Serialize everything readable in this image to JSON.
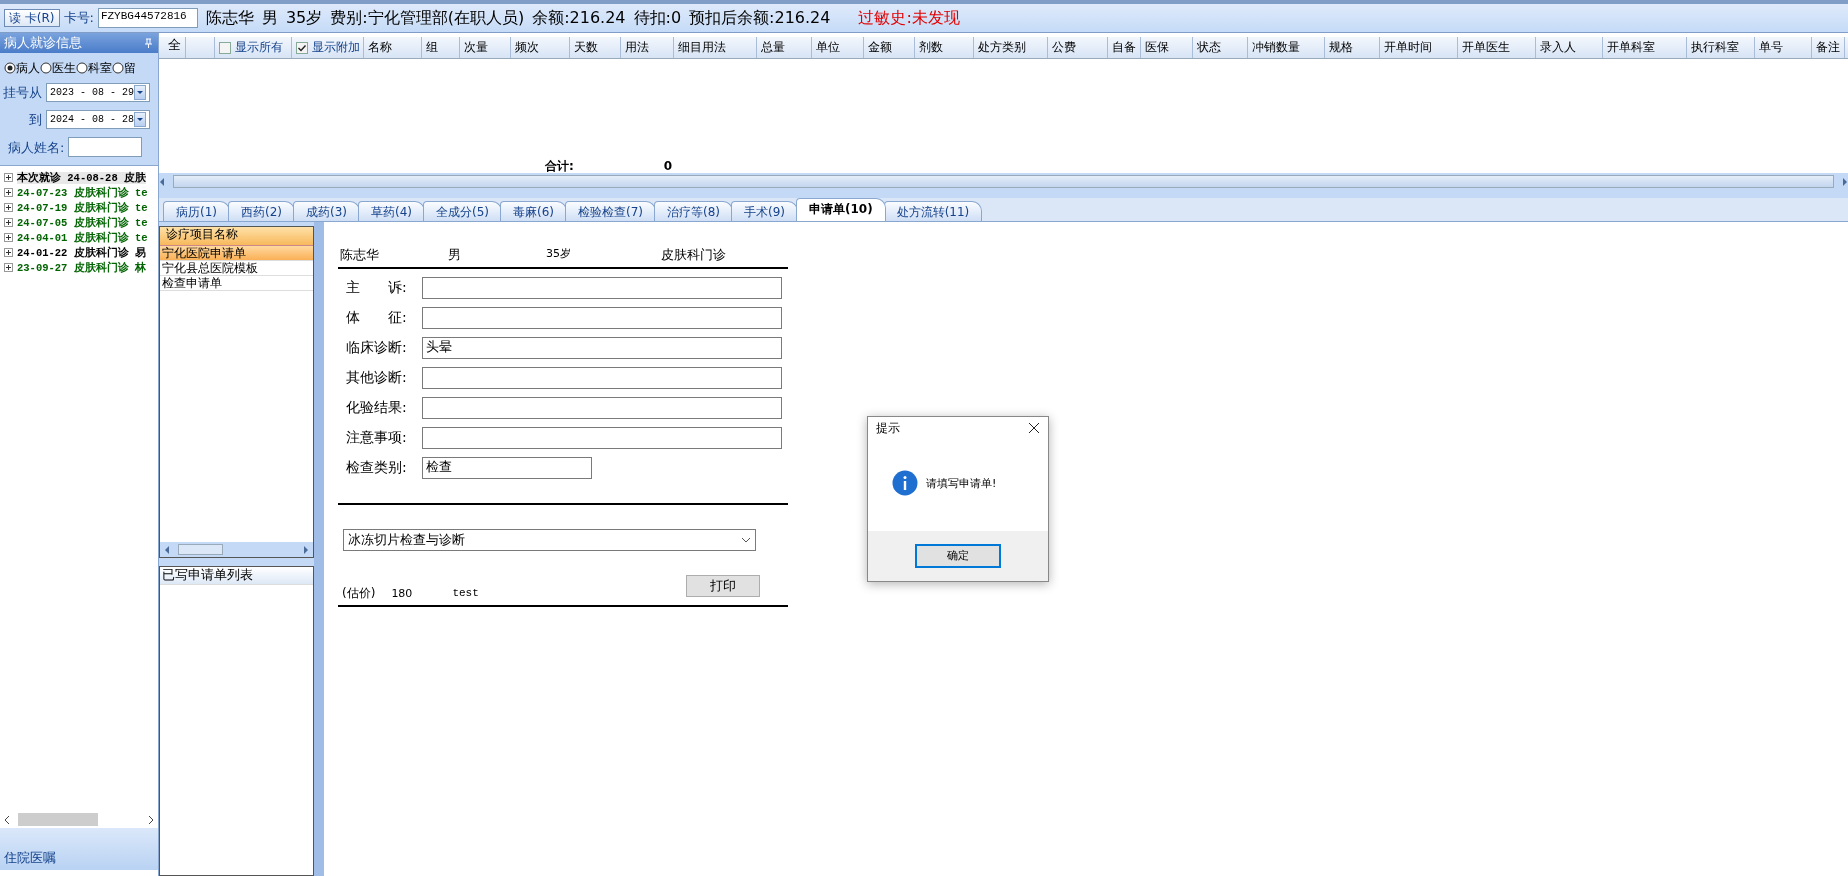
{
  "header": {
    "read_card_button": "读 卡(R)",
    "card_label": "卡号:",
    "card_number": "FZYBG44572816",
    "patient_info": [
      "陈志华",
      "男",
      "35岁",
      "费别:宁化管理部(在职人员)",
      "余额:216.24",
      "待扣:0",
      "预扣后余额:216.24"
    ],
    "allergy": "过敏史:未发现"
  },
  "left_panel": {
    "title": "病人就诊信息",
    "filter_options": [
      {
        "label": "病人",
        "selected": true
      },
      {
        "label": "医生",
        "selected": false
      },
      {
        "label": "科室",
        "selected": false
      },
      {
        "label": "留",
        "selected": false
      }
    ],
    "date_from": {
      "label": "挂号从",
      "value": "2023 - 08 - 29"
    },
    "date_to": {
      "label": "到",
      "value": "2024 - 08 - 28"
    },
    "patient_name": {
      "label": "病人姓名:"
    },
    "visits": [
      {
        "text": "本次就诊 24-08-28 皮肤",
        "color": "#000000",
        "selected": true
      },
      {
        "text": "24-07-23 皮肤科门诊 te",
        "color": "#006400",
        "selected": false
      },
      {
        "text": "24-07-19 皮肤科门诊 te",
        "color": "#006400",
        "selected": false
      },
      {
        "text": "24-07-05 皮肤科门诊 te",
        "color": "#006400",
        "selected": false
      },
      {
        "text": "24-04-01 皮肤科门诊 te",
        "color": "#006400",
        "selected": false
      },
      {
        "text": "24-01-22 皮肤科门诊 易",
        "color": "#000000",
        "selected": false
      },
      {
        "text": "23-09-27 皮肤科门诊 林",
        "color": "#006400",
        "selected": false
      }
    ],
    "bottom_section": "住院医嘱"
  },
  "grid": {
    "first_column": "全",
    "options": [
      {
        "label": "显示所有",
        "checked": false
      },
      {
        "label": "显示附加",
        "checked": true
      }
    ],
    "columns": [
      "名称",
      "组",
      "次量",
      "频次",
      "天数",
      "用法",
      "细目用法",
      "总量",
      "单位",
      "金额",
      "剂数",
      "处方类别",
      "公费",
      "自备",
      "医保",
      "状态",
      "冲销数量",
      "规格",
      "开单时间",
      "开单医生",
      "录入人",
      "开单科室",
      "执行科室",
      "单号",
      "备注"
    ],
    "total_label": "合计:",
    "total_value": "0"
  },
  "tabs": [
    {
      "label": "病历(1)",
      "selected": false
    },
    {
      "label": "西药(2)",
      "selected": false
    },
    {
      "label": "成药(3)",
      "selected": false
    },
    {
      "label": "草药(4)",
      "selected": false
    },
    {
      "label": "全成分(5)",
      "selected": false
    },
    {
      "label": "毒麻(6)",
      "selected": false
    },
    {
      "label": "检验检查(7)",
      "selected": false
    },
    {
      "label": "治疗等(8)",
      "selected": false
    },
    {
      "label": "手术(9)",
      "selected": false
    },
    {
      "label": "申请单(10)",
      "selected": true
    },
    {
      "label": "处方流转(11)",
      "selected": false
    }
  ],
  "templates": {
    "header": "诊疗项目名称",
    "items": [
      {
        "label": "宁化医院申请单",
        "selected": true
      },
      {
        "label": "宁化县总医院模板",
        "selected": false
      },
      {
        "label": "检查申请单",
        "selected": false
      }
    ],
    "written_list_header": "已写申请单列表"
  },
  "form": {
    "patient_line": [
      "陈志华",
      "男",
      "35岁",
      "皮肤科门诊"
    ],
    "fields": [
      {
        "label": "主　　诉:",
        "kind": "long"
      },
      {
        "label": "体　　征:",
        "kind": "long"
      },
      {
        "label": "临床诊断:",
        "value": "头晕",
        "kind": "long"
      },
      {
        "label": "其他诊断:",
        "kind": "long"
      },
      {
        "label": "化验结果:",
        "kind": "long"
      },
      {
        "label": "注意事项:",
        "kind": "long"
      },
      {
        "label": "检查类别:",
        "value": "检查",
        "kind": "short"
      }
    ],
    "exam_select": "冰冻切片检查与诊断",
    "price_label": "(估价)",
    "price": "180",
    "note": "test",
    "print_button": "打印"
  },
  "dialog": {
    "title": "提示",
    "message": "请填写申请单!",
    "ok_button": "确定"
  }
}
